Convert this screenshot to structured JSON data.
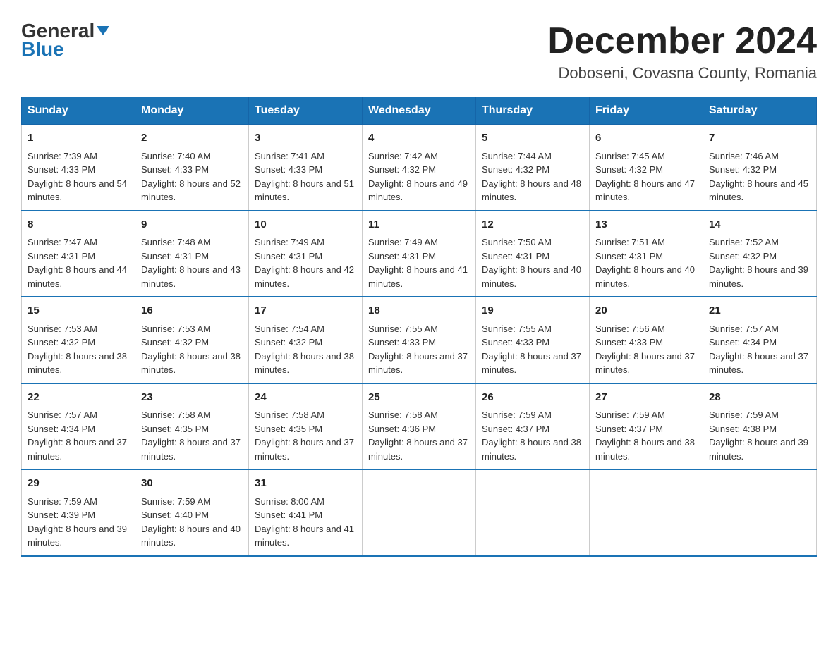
{
  "header": {
    "logo_line1": "General",
    "logo_line2": "Blue",
    "title": "December 2024",
    "subtitle": "Doboseni, Covasna County, Romania"
  },
  "days": [
    "Sunday",
    "Monday",
    "Tuesday",
    "Wednesday",
    "Thursday",
    "Friday",
    "Saturday"
  ],
  "weeks": [
    [
      {
        "num": "1",
        "sunrise": "7:39 AM",
        "sunset": "4:33 PM",
        "daylight": "8 hours and 54 minutes."
      },
      {
        "num": "2",
        "sunrise": "7:40 AM",
        "sunset": "4:33 PM",
        "daylight": "8 hours and 52 minutes."
      },
      {
        "num": "3",
        "sunrise": "7:41 AM",
        "sunset": "4:33 PM",
        "daylight": "8 hours and 51 minutes."
      },
      {
        "num": "4",
        "sunrise": "7:42 AM",
        "sunset": "4:32 PM",
        "daylight": "8 hours and 49 minutes."
      },
      {
        "num": "5",
        "sunrise": "7:44 AM",
        "sunset": "4:32 PM",
        "daylight": "8 hours and 48 minutes."
      },
      {
        "num": "6",
        "sunrise": "7:45 AM",
        "sunset": "4:32 PM",
        "daylight": "8 hours and 47 minutes."
      },
      {
        "num": "7",
        "sunrise": "7:46 AM",
        "sunset": "4:32 PM",
        "daylight": "8 hours and 45 minutes."
      }
    ],
    [
      {
        "num": "8",
        "sunrise": "7:47 AM",
        "sunset": "4:31 PM",
        "daylight": "8 hours and 44 minutes."
      },
      {
        "num": "9",
        "sunrise": "7:48 AM",
        "sunset": "4:31 PM",
        "daylight": "8 hours and 43 minutes."
      },
      {
        "num": "10",
        "sunrise": "7:49 AM",
        "sunset": "4:31 PM",
        "daylight": "8 hours and 42 minutes."
      },
      {
        "num": "11",
        "sunrise": "7:49 AM",
        "sunset": "4:31 PM",
        "daylight": "8 hours and 41 minutes."
      },
      {
        "num": "12",
        "sunrise": "7:50 AM",
        "sunset": "4:31 PM",
        "daylight": "8 hours and 40 minutes."
      },
      {
        "num": "13",
        "sunrise": "7:51 AM",
        "sunset": "4:31 PM",
        "daylight": "8 hours and 40 minutes."
      },
      {
        "num": "14",
        "sunrise": "7:52 AM",
        "sunset": "4:32 PM",
        "daylight": "8 hours and 39 minutes."
      }
    ],
    [
      {
        "num": "15",
        "sunrise": "7:53 AM",
        "sunset": "4:32 PM",
        "daylight": "8 hours and 38 minutes."
      },
      {
        "num": "16",
        "sunrise": "7:53 AM",
        "sunset": "4:32 PM",
        "daylight": "8 hours and 38 minutes."
      },
      {
        "num": "17",
        "sunrise": "7:54 AM",
        "sunset": "4:32 PM",
        "daylight": "8 hours and 38 minutes."
      },
      {
        "num": "18",
        "sunrise": "7:55 AM",
        "sunset": "4:33 PM",
        "daylight": "8 hours and 37 minutes."
      },
      {
        "num": "19",
        "sunrise": "7:55 AM",
        "sunset": "4:33 PM",
        "daylight": "8 hours and 37 minutes."
      },
      {
        "num": "20",
        "sunrise": "7:56 AM",
        "sunset": "4:33 PM",
        "daylight": "8 hours and 37 minutes."
      },
      {
        "num": "21",
        "sunrise": "7:57 AM",
        "sunset": "4:34 PM",
        "daylight": "8 hours and 37 minutes."
      }
    ],
    [
      {
        "num": "22",
        "sunrise": "7:57 AM",
        "sunset": "4:34 PM",
        "daylight": "8 hours and 37 minutes."
      },
      {
        "num": "23",
        "sunrise": "7:58 AM",
        "sunset": "4:35 PM",
        "daylight": "8 hours and 37 minutes."
      },
      {
        "num": "24",
        "sunrise": "7:58 AM",
        "sunset": "4:35 PM",
        "daylight": "8 hours and 37 minutes."
      },
      {
        "num": "25",
        "sunrise": "7:58 AM",
        "sunset": "4:36 PM",
        "daylight": "8 hours and 37 minutes."
      },
      {
        "num": "26",
        "sunrise": "7:59 AM",
        "sunset": "4:37 PM",
        "daylight": "8 hours and 38 minutes."
      },
      {
        "num": "27",
        "sunrise": "7:59 AM",
        "sunset": "4:37 PM",
        "daylight": "8 hours and 38 minutes."
      },
      {
        "num": "28",
        "sunrise": "7:59 AM",
        "sunset": "4:38 PM",
        "daylight": "8 hours and 39 minutes."
      }
    ],
    [
      {
        "num": "29",
        "sunrise": "7:59 AM",
        "sunset": "4:39 PM",
        "daylight": "8 hours and 39 minutes."
      },
      {
        "num": "30",
        "sunrise": "7:59 AM",
        "sunset": "4:40 PM",
        "daylight": "8 hours and 40 minutes."
      },
      {
        "num": "31",
        "sunrise": "8:00 AM",
        "sunset": "4:41 PM",
        "daylight": "8 hours and 41 minutes."
      },
      null,
      null,
      null,
      null
    ]
  ],
  "labels": {
    "sunrise": "Sunrise:",
    "sunset": "Sunset:",
    "daylight": "Daylight:"
  }
}
